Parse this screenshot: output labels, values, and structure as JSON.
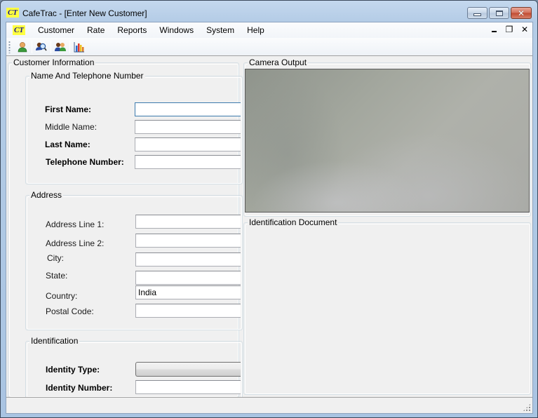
{
  "window": {
    "app_icon_text": "CT",
    "title": "CafeTrac - [Enter New Customer]",
    "minimize_glyph": "",
    "maximize_glyph": "",
    "close_glyph": "✕"
  },
  "menubar": {
    "app_icon_text": "CT",
    "items": [
      {
        "label": "Customer"
      },
      {
        "label": "Rate"
      },
      {
        "label": "Reports"
      },
      {
        "label": "Windows"
      },
      {
        "label": "System"
      },
      {
        "label": "Help"
      }
    ],
    "mdi_minimize_glyph": "‗",
    "mdi_restore_glyph": "❐",
    "mdi_close_glyph": "✕"
  },
  "toolbar": {
    "buttons": [
      {
        "icon": "user-icon"
      },
      {
        "icon": "user-search-icon"
      },
      {
        "icon": "users-icon"
      },
      {
        "icon": "bar-chart-icon"
      }
    ]
  },
  "customer_info": {
    "title": "Customer Information",
    "name_group": {
      "title": "Name And Telephone Number",
      "fields": [
        {
          "label": "First Name:",
          "value": "",
          "required": true
        },
        {
          "label": "Middle Name:",
          "value": "",
          "required": false
        },
        {
          "label": "Last Name:",
          "value": "",
          "required": true
        },
        {
          "label": "Telephone Number:",
          "value": "",
          "required": true
        }
      ]
    },
    "address_group": {
      "title": "Address",
      "fields": [
        {
          "label": "Address Line 1:",
          "value": ""
        },
        {
          "label": "Address Line 2:",
          "value": ""
        },
        {
          "label": "City:",
          "value": ""
        },
        {
          "label": "State:",
          "value": ""
        },
        {
          "label": "Country:",
          "value": "India"
        },
        {
          "label": "Postal Code:",
          "value": ""
        }
      ]
    },
    "identification_group": {
      "title": "Identification",
      "identity_type_label": "Identity Type:",
      "identity_type_value": "",
      "identity_number_label": "Identity Number:",
      "identity_number_value": ""
    }
  },
  "camera": {
    "title": "Camera Output"
  },
  "id_document": {
    "title": "Identification Document"
  },
  "statusbar": {
    "text": ""
  }
}
